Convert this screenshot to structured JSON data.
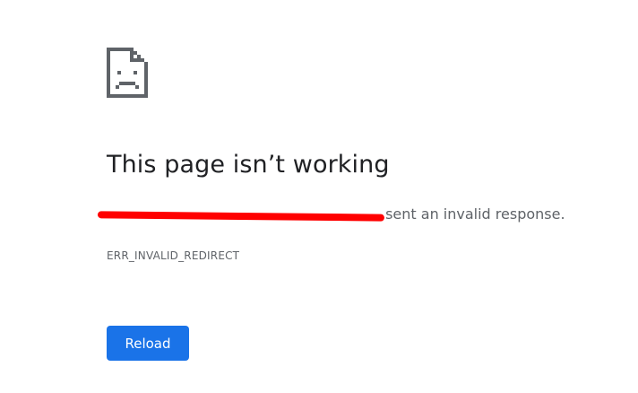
{
  "icon": "sad-page-icon",
  "title": "This page isn’t working",
  "message": {
    "host": "",
    "suffix": "sent an invalid response."
  },
  "error_code": "ERR_INVALID_REDIRECT",
  "reload_label": "Reload",
  "colors": {
    "title": "#202124",
    "text": "#5f6368",
    "button": "#1a73e8",
    "redaction": "#ff0000"
  }
}
